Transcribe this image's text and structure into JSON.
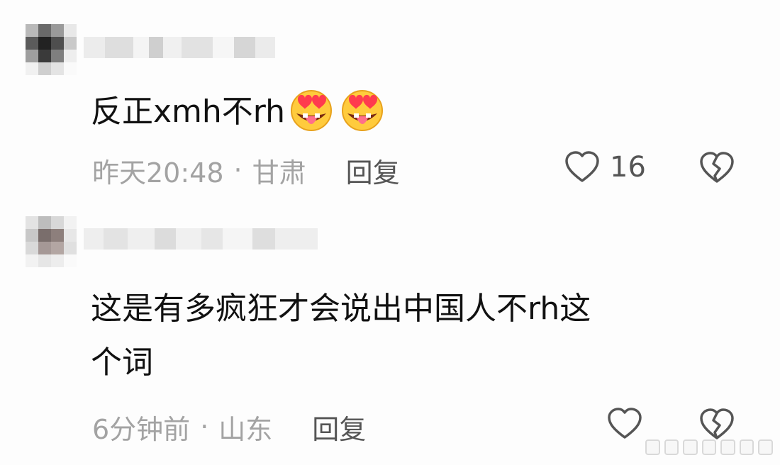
{
  "comments": [
    {
      "text": "反正xmh不rh",
      "emojis": [
        "heart-eyes-tongue-emoji",
        "heart-eyes-tongue-emoji"
      ],
      "time": "昨天20:48",
      "separator": "·",
      "location": "甘肃",
      "reply_label": "回复",
      "like_count": "16"
    },
    {
      "text": "这是有多疯狂才会说出中国人不rh这\n个词",
      "time": "6分钟前",
      "separator": "·",
      "location": "山东",
      "reply_label": "回复",
      "like_count": ""
    }
  ],
  "colors": {
    "text_primary": "#111111",
    "text_meta": "#a3a3a3",
    "text_action": "#555555",
    "background": "#fdfdfd"
  },
  "icons": [
    "heart-outline-icon",
    "broken-heart-icon"
  ]
}
